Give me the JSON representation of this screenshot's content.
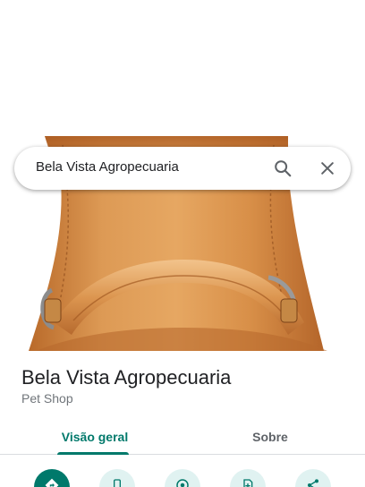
{
  "search": {
    "query": "Bela Vista Agropecuaria",
    "search_icon": "search-icon",
    "close_icon": "close-icon"
  },
  "place": {
    "name": "Bela Vista Agropecuaria",
    "category": "Pet Shop",
    "photo": "leather-saddle-photo"
  },
  "tabs": [
    {
      "label": "Visão geral",
      "active": true
    },
    {
      "label": "Sobre",
      "active": false
    }
  ],
  "actions": [
    {
      "icon": "directions-icon"
    },
    {
      "icon": "phone-icon"
    },
    {
      "icon": "location-icon"
    },
    {
      "icon": "save-icon"
    },
    {
      "icon": "share-icon"
    }
  ],
  "colors": {
    "accent": "#00796b",
    "accent_light": "#e0f2f1",
    "text_primary": "#202124",
    "text_secondary": "#70757a",
    "leather": "#d9914a"
  }
}
